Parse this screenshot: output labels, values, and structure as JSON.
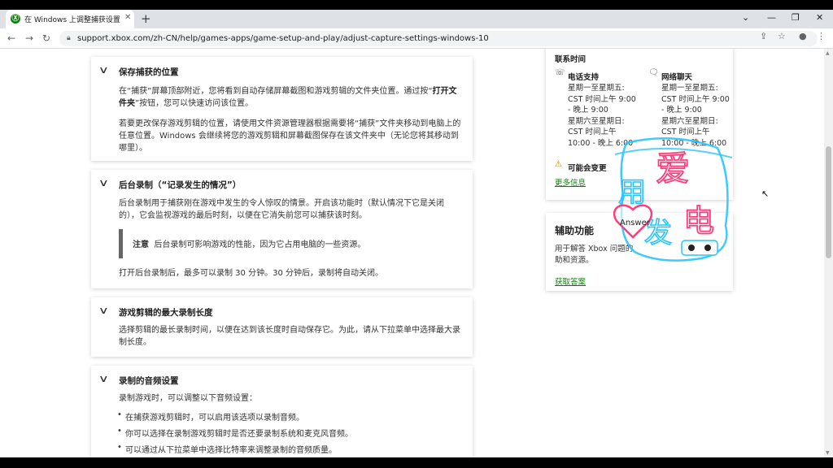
{
  "browser": {
    "tab_title": "在 Windows 上调整捕获设置 | X",
    "tab_favicon": "Ⓧ",
    "url": "support.xbox.com/zh-CN/help/games-apps/game-setup-and-play/adjust-capture-settings-windows-10"
  },
  "sections": [
    {
      "title": "保存捕获的位置",
      "para1_a": "在“捕获”屏幕顶部附近，您将看到自动存储屏幕截图和游戏剪辑的文件夹位置。通过按“",
      "para1_b": "打开文件夹",
      "para1_c": "”按钮，您可以快速访问该位置。",
      "para2": "若要更改保存游戏剪辑的位置，请使用文件资源管理器根据需要将“捕获”文件夹移动到电脑上的任意位置。Windows 会继续将您的游戏剪辑和屏幕截图保存在该文件夹中（无论您将其移动到哪里）。"
    },
    {
      "title": "后台录制（“记录发生的情况”）",
      "para1": "后台录制用于捕获刚在游戏中发生的令人惊叹的情景。开启该功能时（默认情况下它是关闭的），它会监视游戏的最后时刻，以便在它消失前您可以捕获该时刻。",
      "note_label": "注意",
      "note_text": "后台录制可影响游戏的性能，因为它占用电脑的一些资源。",
      "para2": "打开后台录制后，最多可以录制 30 分钟。30 分钟后，录制将自动关闭。"
    },
    {
      "title": "游戏剪辑的最大录制长度",
      "para1": "选择剪辑的最长录制时间，以便在达到该长度时自动保存它。为此，请从下拉菜单中选择最大录制长度。"
    },
    {
      "title": "录制的音频设置",
      "para1": "录制游戏时，可以调整以下音频设置：",
      "bullets": [
        "在捕获游戏剪辑时，可以启用该选项以录制音频。",
        "你可以选择在录制游戏剪辑时是否还要录制系统和麦克风音频。",
        "可以通过从下拉菜单中选择比特率来调整录制的音频质量。"
      ]
    }
  ],
  "contact": {
    "title": "联系时间",
    "phone": {
      "label": "电话支持",
      "lines": [
        "星期一至星期五:",
        "CST 时间上午 9:00",
        "- 晚上 9:00",
        "星期六至星期日:",
        "CST 时间上午",
        "10:00 - 晚上 6:00"
      ]
    },
    "chat": {
      "label": "网络聊天",
      "lines": [
        "星期一至星期五:",
        "CST 时间上午 9:00",
        "- 晚上 9:00",
        "星期六至星期日:",
        "CST 时间上午",
        "10:00 - 晚上 6:00"
      ]
    },
    "warning": "可能会变更",
    "more_link": "更多信息"
  },
  "accessibility": {
    "title": "辅助功能",
    "desc_1": "用于解答 Xbox 问题的",
    "desc_2": "助和资源。",
    "link": "获取答案"
  },
  "watermark": {
    "chars": [
      "用",
      "爱",
      "发",
      "电"
    ],
    "badge": "Answer"
  },
  "colors": {
    "accent_green": "#107c10",
    "watermark_cyan": "#29c4ff",
    "watermark_pink": "#ff3d7a"
  }
}
